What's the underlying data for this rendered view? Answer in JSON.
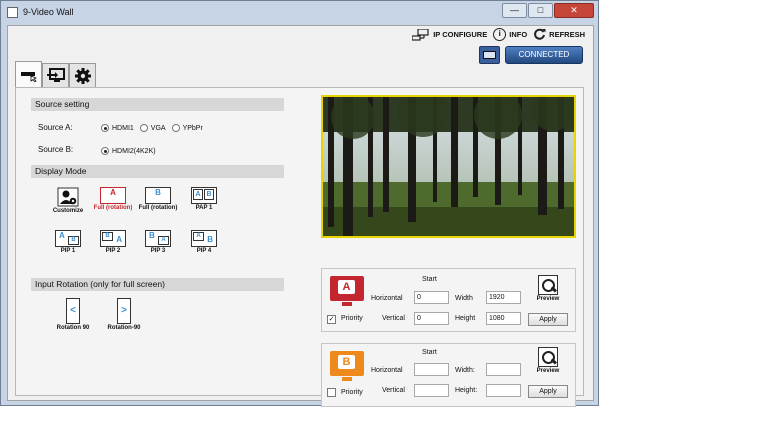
{
  "window": {
    "title": "9-Video Wall",
    "controls": [
      "—",
      "□",
      "✕"
    ]
  },
  "toolbar": {
    "ip_config": "IP CONFIGURE",
    "info": "INFO",
    "refresh": "REFRESH",
    "connected": "CONNECTED"
  },
  "tabs": [
    {
      "icon": "source-tab-icon"
    },
    {
      "icon": "display-tab-icon"
    },
    {
      "icon": "settings-gear-icon"
    }
  ],
  "source_setting": {
    "title": "Source setting",
    "source_a": {
      "label": "Source A:",
      "options": [
        "HDMI1",
        "VGA",
        "YPbPr"
      ],
      "selected": "HDMI1"
    },
    "source_b": {
      "label": "Source B:",
      "options": [
        "HDMI2(4K2K)"
      ],
      "selected": "HDMI2(4K2K)"
    }
  },
  "display_mode": {
    "title": "Display Mode",
    "modes": [
      {
        "label": "Customize",
        "letters": ""
      },
      {
        "label": "Full (rotation)",
        "letters": "A",
        "selected": true
      },
      {
        "label": "Full (rotation)",
        "letters": "B"
      },
      {
        "label": "PAP 1",
        "letters": "AB"
      },
      {
        "label": "PIP 1",
        "letters": "AB"
      },
      {
        "label": "PIP 2",
        "letters": "BA"
      },
      {
        "label": "PIP 3",
        "letters": "BA"
      },
      {
        "label": "PIP 4",
        "letters": "AB"
      }
    ]
  },
  "input_rotation": {
    "title": "Input Rotation (only for full screen)",
    "options": [
      {
        "label": "Rotation 90",
        "glyph": "<"
      },
      {
        "label": "Rotation-90",
        "glyph": ">"
      }
    ]
  },
  "source_a_config": {
    "letter": "A",
    "color": "#c3262e",
    "start_label": "Start",
    "horizontal_label": "Horizontal",
    "horizontal_value": "0",
    "vertical_label": "Vertical",
    "vertical_value": "0",
    "width_label": "Width",
    "width_value": "1920",
    "height_label": "Height",
    "height_value": "1080",
    "priority_label": "Priority",
    "priority_checked": true,
    "preview_label": "Preview",
    "apply_label": "Apply"
  },
  "source_b_config": {
    "letter": "B",
    "color": "#ee8a1b",
    "start_label": "Start",
    "horizontal_label": "Horizontal",
    "horizontal_value": "",
    "vertical_label": "Vertical",
    "vertical_value": "",
    "width_label": "Width:",
    "width_value": "",
    "height_label": "Height:",
    "height_value": "",
    "priority_label": "Priority",
    "priority_checked": false,
    "preview_label": "Preview",
    "apply_label": "Apply"
  }
}
